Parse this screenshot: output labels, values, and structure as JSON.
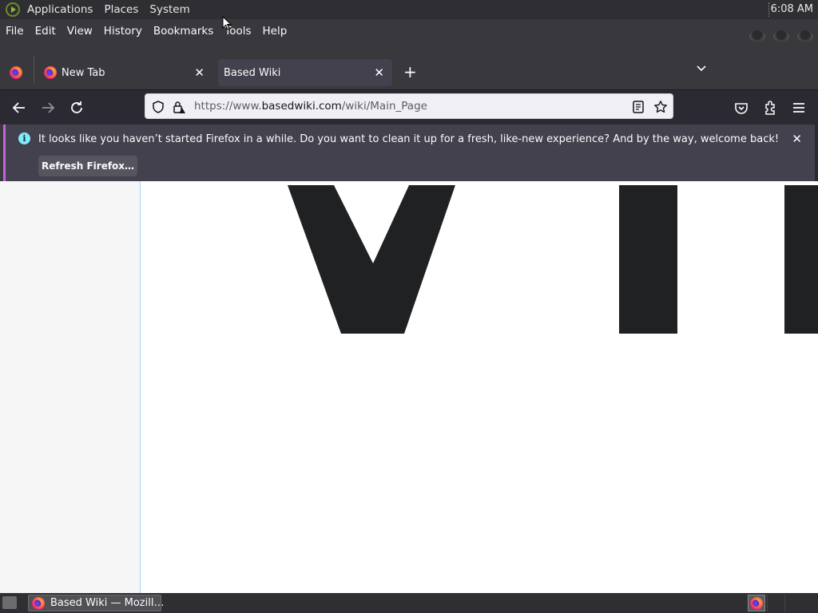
{
  "panel": {
    "menus": [
      "Applications",
      "Places",
      "System"
    ],
    "clock": "6:08 AM"
  },
  "menubar": {
    "items": [
      "File",
      "Edit",
      "View",
      "History",
      "Bookmarks",
      "Tools",
      "Help"
    ]
  },
  "tabs": [
    {
      "label": "New Tab",
      "active": false
    },
    {
      "label": "Based Wiki",
      "active": true
    }
  ],
  "urlbar": {
    "prefix": "https://www.",
    "domain": "basedwiki.com",
    "path": "/wiki/Main_Page"
  },
  "notification": {
    "message": "It looks like you haven’t started Firefox in a while. Do you want to clean it up for a fresh, like-new experience? And by the way, welcome back!",
    "button": "Refresh Firefox…"
  },
  "taskbar": {
    "task_label": "Based Wiki — Mozill…"
  },
  "colors": {
    "chrome": "#38383d",
    "toolbar": "#2b2a33",
    "notif_accent": "#c062e6",
    "info_icon": "#80ebff",
    "page_text": "#202122"
  }
}
